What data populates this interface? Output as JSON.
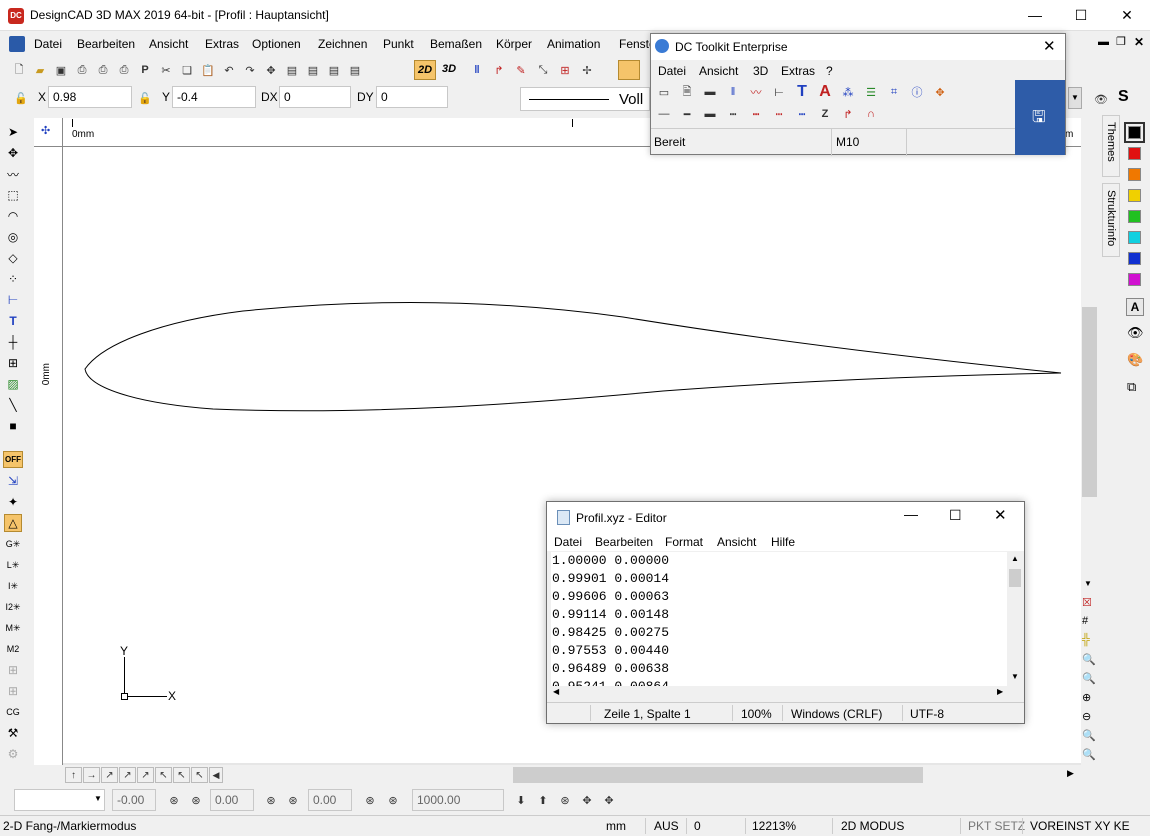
{
  "window": {
    "title": "DesignCAD 3D MAX 2019 64-bit - [Profil : Hauptansicht]",
    "logo": "DC",
    "min": "—",
    "max": "☐",
    "close": "✕"
  },
  "menu": [
    "Datei",
    "Bearbeiten",
    "Ansicht",
    "Extras",
    "Optionen",
    "Zeichnen",
    "Punkt",
    "Bemaßen",
    "Körper",
    "Animation",
    "Fenste"
  ],
  "toolbar": {
    "btn2d": "2D",
    "btn3d": "3D"
  },
  "coords": {
    "x_label": "X",
    "x_value": "0.98",
    "y_label": "Y",
    "y_value": "-0.4",
    "dx_label": "DX",
    "dx_value": "0",
    "dy_label": "DY",
    "dy_value": "0",
    "linetype": "Voll"
  },
  "rulers": {
    "top_zero": "0mm",
    "left_zero": "0mm",
    "right_label": "m"
  },
  "dctoolkit": {
    "title": "DC Toolkit Enterprise",
    "menu": [
      "Datei",
      "Ansicht",
      "3D",
      "Extras",
      "?"
    ],
    "status_left": "Bereit",
    "status_mid": "M10"
  },
  "side_tabs": {
    "themes": "Themes",
    "struktur": "Strukturinfo"
  },
  "swatches": [
    "#000000",
    "#e01010",
    "#f07800",
    "#f0d000",
    "#20c020",
    "#10d0e0",
    "#1030d0",
    "#d010d0"
  ],
  "editor": {
    "title": "Profil.xyz - Editor",
    "menu": [
      "Datei",
      "Bearbeiten",
      "Format",
      "Ansicht",
      "Hilfe"
    ],
    "lines": [
      "1.00000 0.00000",
      "0.99901 0.00014",
      "0.99606 0.00063",
      "0.99114 0.00148",
      "0.98425 0.00275",
      "0.97553 0.00440",
      "0.96489 0.00638",
      "0.95241 0.00864"
    ],
    "status": {
      "pos": "Zeile 1, Spalte 1",
      "zoom": "100%",
      "eol": "Windows (CRLF)",
      "enc": "UTF-8"
    }
  },
  "bottom_toolbar": {
    "f1": "-0.00",
    "f2": "0.00",
    "f3": "0.00",
    "f4": "1000.00"
  },
  "left_palette": {
    "off": "OFF"
  },
  "axis": {
    "y": "Y",
    "x": "X"
  },
  "statusbar": {
    "mode": "2-D Fang-/Markiermodus",
    "unit": "mm",
    "aus": "AUS",
    "zero": "0",
    "zoom": "12213%",
    "mode2d": "2D MODUS",
    "pkt": "PKT SETZ",
    "voreinst": "VOREINST XY KE"
  }
}
